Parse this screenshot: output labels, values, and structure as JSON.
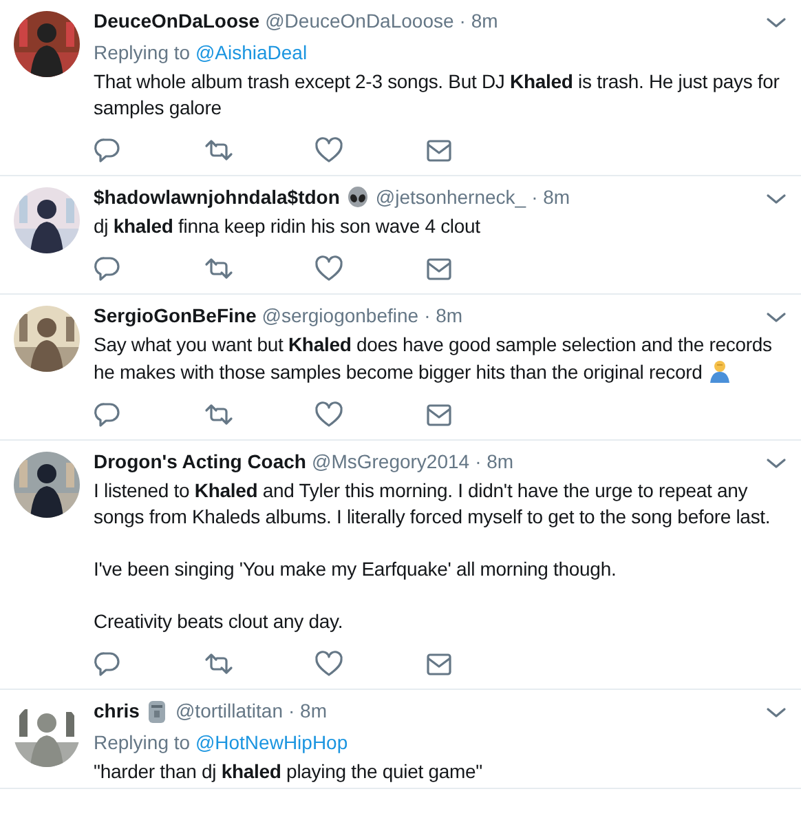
{
  "tweets": [
    {
      "name": "DeuceOnDaLoose",
      "handle": "@DeuceOnDaLooose",
      "time": "· 8m",
      "replying_to": {
        "label": "Replying to",
        "user": "@AishiaDeal"
      },
      "paragraphs": [
        "That whole album trash except 2-3 songs. But DJ **Khaled** is trash. He just pays for samples galore"
      ]
    },
    {
      "name": "$hadowlawnjohndala$tdon",
      "name_icon": {
        "kind": "alien"
      },
      "handle": "@jetsonherneck_",
      "time": "· 8m",
      "paragraphs": [
        "dj **khaled** finna keep ridin his son wave 4 clout"
      ]
    },
    {
      "name": "SergioGonBeFine",
      "handle": "@sergiogonbefine",
      "time": "· 8m",
      "paragraphs": [
        "Say what you want but **Khaled** does have good sample selection and the records he makes with those samples become bigger hits than the original record"
      ],
      "text_icon": {
        "kind": "person"
      }
    },
    {
      "name": "Drogon's Acting Coach",
      "handle": "@MsGregory2014",
      "time": "· 8m",
      "paragraphs": [
        "I listened to **Khaled** and Tyler this morning. I didn't have the urge to repeat any songs from Khaleds albums. I literally forced myself to get to the song before last.",
        "I've been singing 'You make my Earfquake' all morning though.",
        "Creativity beats clout any day."
      ]
    },
    {
      "name": "chris",
      "name_icon": {
        "kind": "moai"
      },
      "handle": "@tortillatitan",
      "time": "· 8m",
      "replying_to": {
        "label": "Replying to",
        "user": "@HotNewHipHop"
      },
      "paragraphs": [
        "\"harder than dj **khaled** playing the quiet game\""
      ],
      "no_actions": true
    }
  ]
}
